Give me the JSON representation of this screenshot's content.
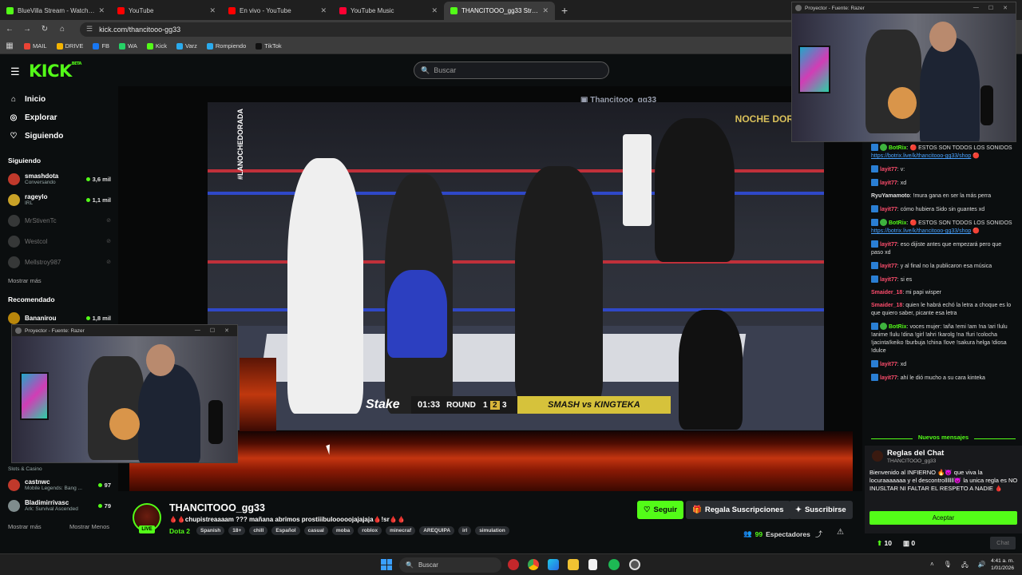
{
  "browser": {
    "tabs": [
      {
        "title": "BlueVilla Stream - Watch Live on K",
        "color": "#53fc18",
        "active": false
      },
      {
        "title": "YouTube",
        "color": "#ff0000",
        "active": false
      },
      {
        "title": "En vivo - YouTube",
        "color": "#ff0000",
        "active": false
      },
      {
        "title": "YouTube Music",
        "color": "#ff0033",
        "active": false
      },
      {
        "title": "THANCITOOO_gg33 Stream",
        "color": "#53fc18",
        "active": true
      }
    ],
    "url": "kick.com/thancitooo-gg33",
    "bookmarks": [
      {
        "label": "MAIL",
        "color": "#ea4335"
      },
      {
        "label": "DRIVE",
        "color": "#f4b400"
      },
      {
        "label": "FB",
        "color": "#1877f2"
      },
      {
        "label": "WA",
        "color": "#25d366"
      },
      {
        "label": "Kick",
        "color": "#53fc18"
      },
      {
        "label": "Varz",
        "color": "#2aabee"
      },
      {
        "label": "Rompiendo",
        "color": "#2aabee"
      },
      {
        "label": "TikTok",
        "color": "#111111"
      }
    ]
  },
  "header": {
    "logo": "KICK",
    "logo_beta": "BETA",
    "search_placeholder": "Buscar"
  },
  "sidebar": {
    "nav": [
      {
        "label": "Inicio",
        "icon": "home-icon"
      },
      {
        "label": "Explorar",
        "icon": "compass-icon"
      },
      {
        "label": "Siguiendo",
        "icon": "heart-icon"
      }
    ],
    "following_title": "Siguiendo",
    "following": [
      {
        "name": "smashdota",
        "category": "Conversando",
        "viewers": "3,6 mil",
        "online": true,
        "color": "#c0392b"
      },
      {
        "name": "rageylo",
        "category": "IRL",
        "viewers": "1,1 mil",
        "online": true,
        "color": "#c9a227"
      },
      {
        "name": "MrStivenTc",
        "category": "",
        "viewers": "",
        "online": false,
        "color": "#888"
      },
      {
        "name": "Westcol",
        "category": "",
        "viewers": "",
        "online": false,
        "color": "#888"
      },
      {
        "name": "Mellstroy987",
        "category": "",
        "viewers": "",
        "online": false,
        "color": "#888"
      }
    ],
    "show_more": "Mostrar más",
    "recommended_title": "Recomendado",
    "recommended_top": {
      "name": "Bananirou",
      "viewers": "1,8 mil",
      "color": "#b8860b"
    },
    "recommended_bottom": [
      {
        "name": "castnwc",
        "category": "Mobile Legends: Bang ...",
        "viewers": "97",
        "color": "#c0392b"
      },
      {
        "name": "Bladimirrivasc",
        "category": "Ark: Survival Ascended",
        "viewers": "79",
        "color": "#7f8c8d"
      }
    ],
    "slots_category": "Slots & Casino",
    "show_more_bottom": "Mostrar más",
    "show_less": "Mostrar Menos"
  },
  "video": {
    "overlay_channel": "Thancitooo_gg33",
    "lanoche": "#LANOCHEDORADA",
    "dorada": "NOCHE DORADA",
    "stake": "Stake",
    "time": "01:33",
    "round_label": "ROUND",
    "rounds": [
      "1",
      "2",
      "3"
    ],
    "current_round": "2",
    "matchup": "SMASH vs KINGTEKA"
  },
  "stream": {
    "channel": "THANCITOOO_gg33",
    "live": "LIVE",
    "title": "🩸🩸chupistreaaaam ??? mañana abrimos prostiiibulooooojajajaja🩸!sr🩸🩸",
    "game": "Dota 2",
    "tags": [
      "Spanish",
      "18+",
      "chill",
      "Español",
      "casual",
      "moba",
      "roblox",
      "minecraf",
      "AREQUIPA",
      "irl",
      "simulation"
    ],
    "follow": "Seguir",
    "gift": "Regala Suscripciones",
    "subscribe": "Suscribirse",
    "viewers_count": "99",
    "viewers_label": "Espectadores"
  },
  "chat": {
    "messages": [
      {
        "user": "BotRix",
        "ucolor": "#53fc18",
        "text": "🔴 ESTOS SON TODOS LOS SONIDOS ",
        "link": "https://botrix.live/k/thancitooo-gg33/shop",
        "tail": " 🔴",
        "bot": true
      },
      {
        "user": "layit77",
        "ucolor": "#ff4d6d",
        "text": "v:"
      },
      {
        "user": "layit77",
        "ucolor": "#ff4d6d",
        "text": "xd"
      },
      {
        "user": "RyuYamamoto",
        "ucolor": "#e0e0e0",
        "text": "!mura gana en ser la más perra",
        "nobadge": true
      },
      {
        "user": "layit77",
        "ucolor": "#ff4d6d",
        "text": "cómo hubiera Sido sin guantes xd"
      },
      {
        "user": "BotRix",
        "ucolor": "#53fc18",
        "text": "🔴 ESTOS SON TODOS LOS SONIDOS ",
        "link": "https://botrix.live/k/thancitooo-gg33/shop",
        "tail": " 🔴",
        "bot": true
      },
      {
        "user": "layit77",
        "ucolor": "#ff4d6d",
        "text": "eso dijiste antes que empezará pero que paso xd"
      },
      {
        "user": "layit77",
        "ucolor": "#ff4d6d",
        "text": "y al final no la publicaron esa música"
      },
      {
        "user": "layit77",
        "ucolor": "#ff4d6d",
        "text": "si es"
      },
      {
        "user": "Smaider_18",
        "ucolor": "#ff4d6d",
        "text": "mi papi wisper",
        "nobadge": true
      },
      {
        "user": "Smaider_18",
        "ucolor": "#ff4d6d",
        "text": "quien le habrá echó la letra a choque es lo que quiero saber, picante esa letra",
        "nobadge": true
      },
      {
        "user": "BotRix",
        "ucolor": "#53fc18",
        "text": "voces mujer: !aña !emi !am !na !ari !lulu !anime !lulu !dina !girl !ahri !karolg !na !furi !colocha !jacinta!keiko !burbuja !china !love !sakura helga !diosa !dulce",
        "bot": true
      },
      {
        "user": "layit77",
        "ucolor": "#ff4d6d",
        "text": "xd"
      },
      {
        "user": "layit77",
        "ucolor": "#ff4d6d",
        "text": "ahí le dió mucho a su cara kinteka"
      }
    ],
    "new_messages": "Nuevos mensajes",
    "rules_title": "Reglas del Chat",
    "rules_channel": "THANCITOOO_gg33",
    "rules_body": "Bienvenido al INFIERNO 🔥👿 que viva la locuraaaaaaa y el descontrolllllll👿 la unica regla es NO INUSLTAR NI FALTAR EL RESPETO A NADIE 🩸",
    "accept": "Aceptar",
    "points": "10",
    "gifts": "0",
    "chat_button": "Chat"
  },
  "projector": {
    "title": "Proyector - Fuente: Razer"
  },
  "taskbar": {
    "search": "Buscar",
    "time": "4:41 a. m.",
    "date": "1/01/2026"
  }
}
